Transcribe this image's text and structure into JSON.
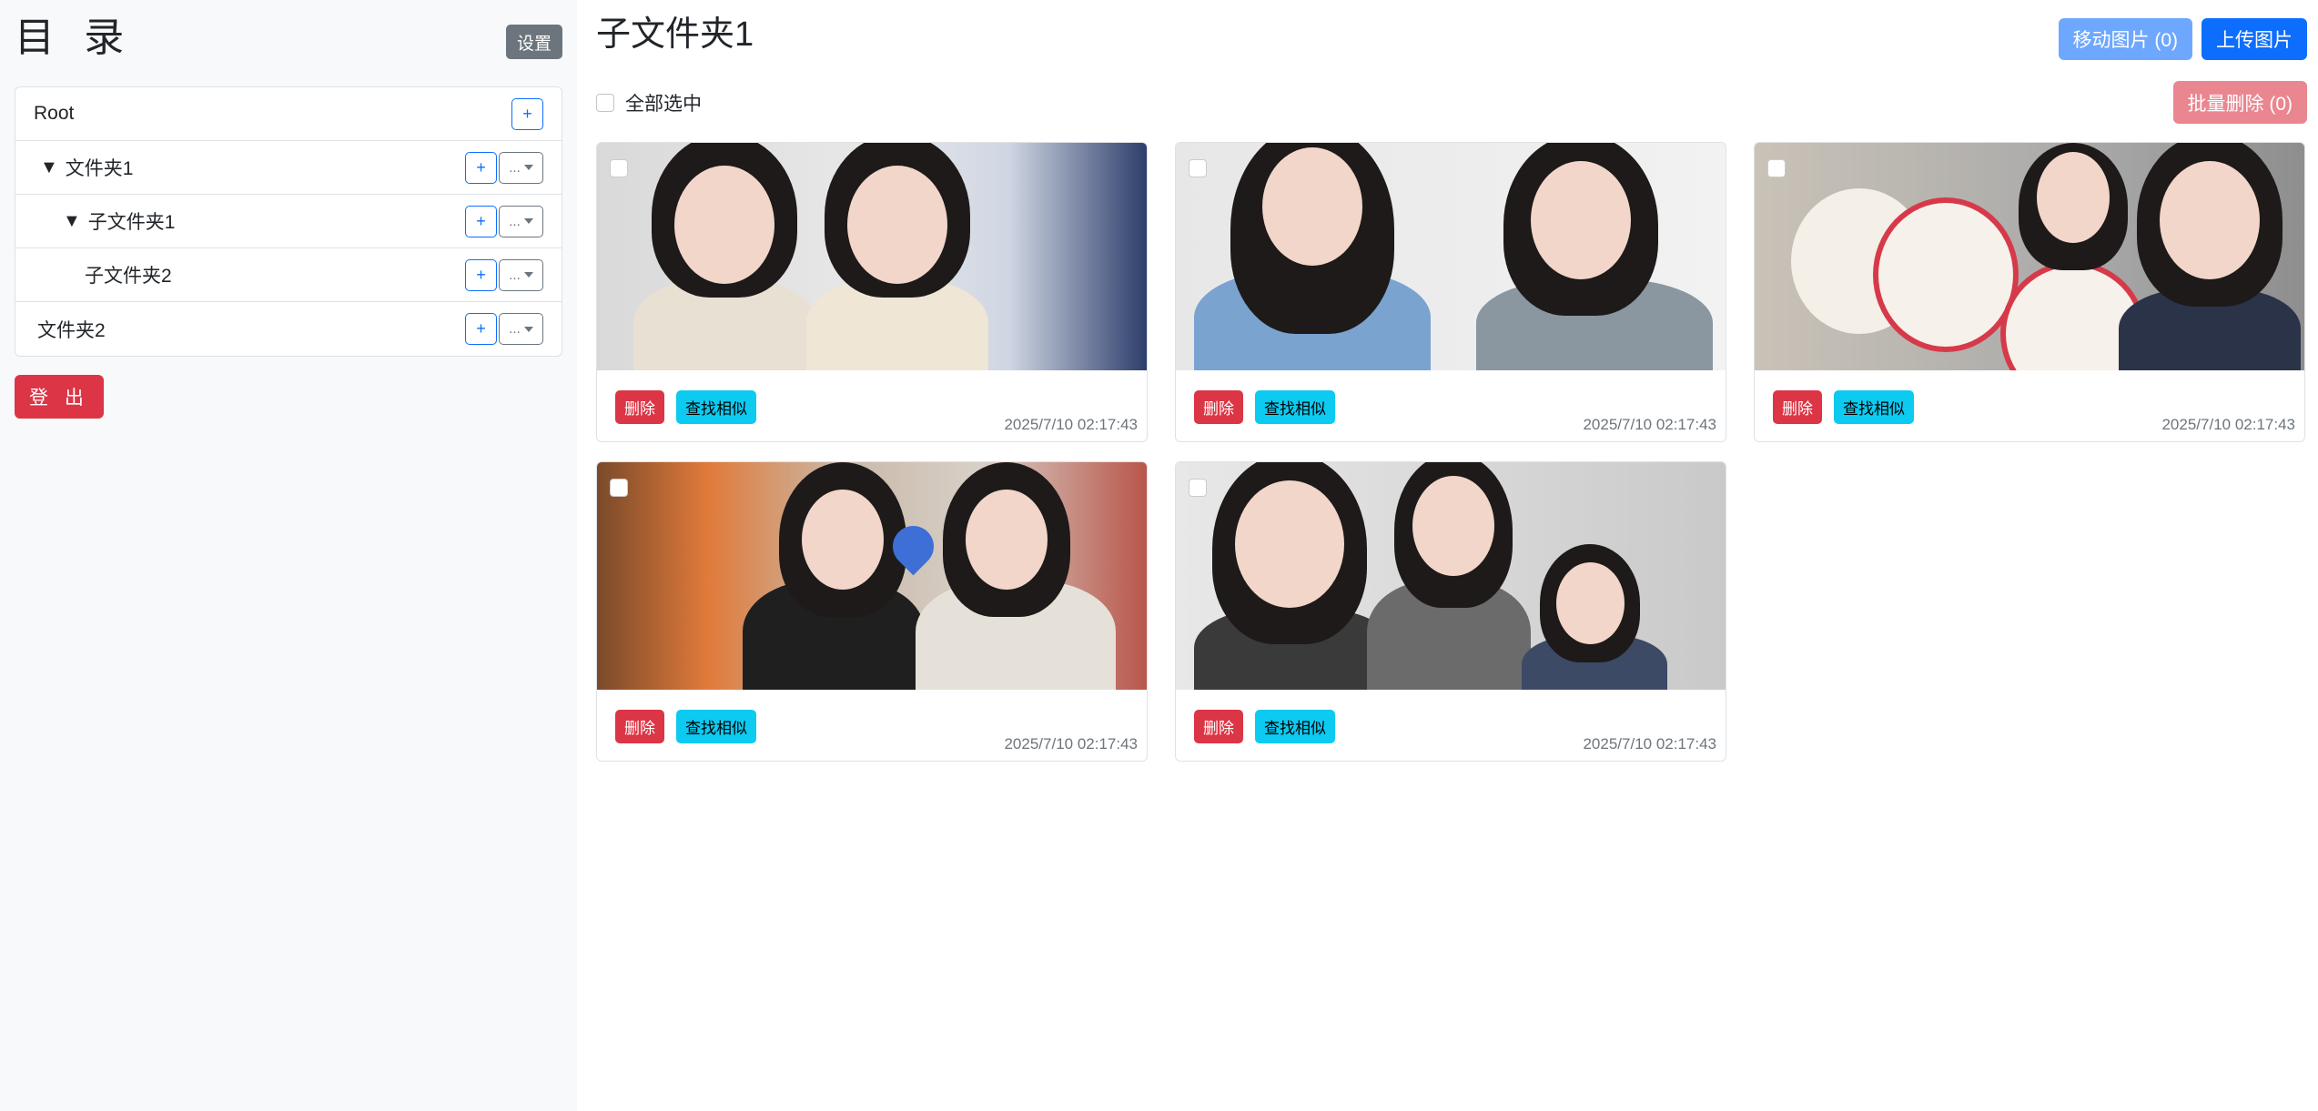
{
  "sidebar": {
    "title": "目 录",
    "settings_label": "设置",
    "logout_label": "登 出",
    "tree": [
      {
        "label": "Root",
        "arrow": "",
        "has_more": false
      },
      {
        "label": "文件夹1",
        "arrow": "▼",
        "has_more": true
      },
      {
        "label": "子文件夹1",
        "arrow": "▼",
        "has_more": true
      },
      {
        "label": "子文件夹2",
        "arrow": "",
        "has_more": true
      },
      {
        "label": "文件夹2",
        "arrow": "",
        "has_more": true
      }
    ],
    "plus_label": "+",
    "more_label": "..."
  },
  "main": {
    "title": "子文件夹1",
    "move_label": "移动图片 (0)",
    "upload_label": "上传图片",
    "select_all_label": "全部选中",
    "batch_delete_label": "批量删除 (0)",
    "cards": [
      {
        "delete_label": "删除",
        "similar_label": "查找相似",
        "date": "2025/7/10 02:17:43"
      },
      {
        "delete_label": "删除",
        "similar_label": "查找相似",
        "date": "2025/7/10 02:17:43"
      },
      {
        "delete_label": "删除",
        "similar_label": "查找相似",
        "date": "2025/7/10 02:17:43"
      },
      {
        "delete_label": "删除",
        "similar_label": "查找相似",
        "date": "2025/7/10 02:17:43"
      },
      {
        "delete_label": "删除",
        "similar_label": "查找相似",
        "date": "2025/7/10 02:17:43"
      }
    ]
  },
  "colors": {
    "primary": "#0d6efd",
    "danger": "#dc3545",
    "info": "#0dcaf0",
    "secondary": "#6c757d"
  }
}
